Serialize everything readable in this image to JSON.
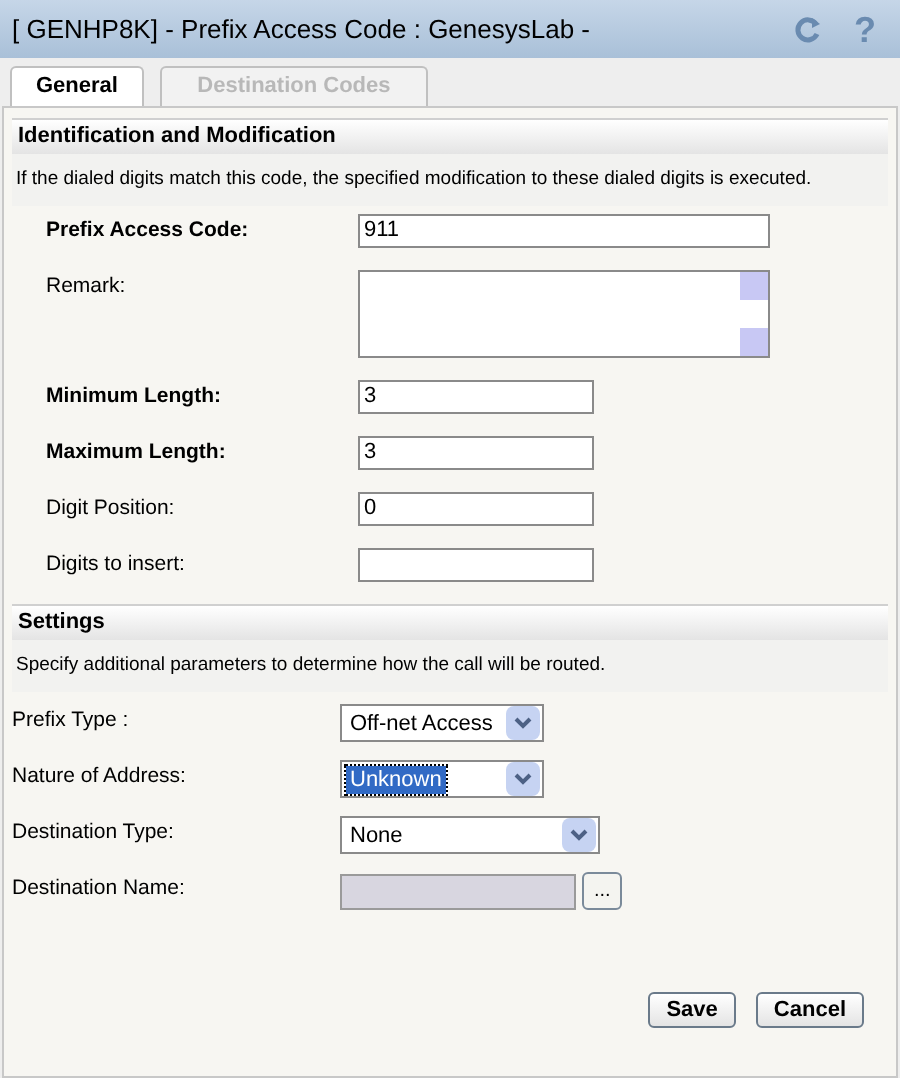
{
  "window": {
    "title": "[ GENHP8K] - Prefix Access Code : GenesysLab -",
    "help": "?"
  },
  "tabs": [
    {
      "label": "General",
      "selected": true
    },
    {
      "label": "Destination Codes",
      "selected": false
    }
  ],
  "sections": [
    {
      "title": "Identification and Modification",
      "description": "If the dialed digits match this code, the specified modification to these dialed digits is executed.",
      "indented": true,
      "fields": [
        {
          "kind": "text",
          "label": "Prefix Access Code:",
          "required": true,
          "value": "911",
          "wide": true
        },
        {
          "kind": "textarea",
          "label": "Remark:",
          "required": false
        },
        {
          "kind": "text",
          "label": "Minimum Length:",
          "required": true,
          "value": "3",
          "wide": false
        },
        {
          "kind": "text",
          "label": "Maximum Length:",
          "required": true,
          "value": "3",
          "wide": false
        },
        {
          "kind": "text",
          "label": "Digit Position:",
          "required": false,
          "value": "0",
          "wide": false
        },
        {
          "kind": "text",
          "label": "Digits to insert:",
          "required": false,
          "wide": false
        }
      ]
    },
    {
      "title": "Settings",
      "description": "Specify additional parameters to determine how the call will be routed.",
      "indented": false,
      "fields": [
        {
          "kind": "select",
          "label": "Prefix Type :",
          "value": "Off-net Access",
          "focused": false,
          "wide": false
        },
        {
          "kind": "select",
          "label": "Nature of Address:",
          "value": "Unknown",
          "focused": true,
          "wide": false
        },
        {
          "kind": "select",
          "label": "Destination Type:",
          "value": "None",
          "focused": false,
          "wide": true
        },
        {
          "kind": "picker",
          "label": "Destination Name:",
          "disabled": true,
          "button": "..."
        }
      ]
    }
  ],
  "buttons": [
    {
      "label": "Save"
    },
    {
      "label": "Cancel"
    }
  ]
}
